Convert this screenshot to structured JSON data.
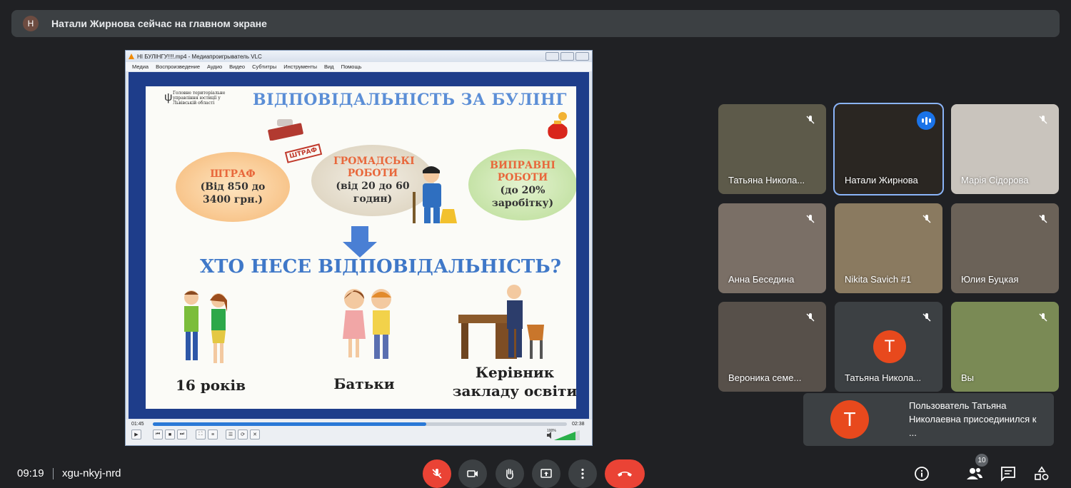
{
  "banner": {
    "avatar_letter": "Н",
    "text": "Натали Жирнова сейчас на главном экране"
  },
  "vlc": {
    "title": "НІ БУЛІНГУ!!!!.mp4 - Медиапроигрыватель VLC",
    "menu": [
      "Медиа",
      "Воспроизведение",
      "Аудио",
      "Видео",
      "Субтитры",
      "Инструменты",
      "Вид",
      "Помощь"
    ],
    "time_elapsed": "01:45",
    "time_total": "02:38",
    "progress": 0.66,
    "volume_label": "100%"
  },
  "slide": {
    "org": "Головне територіальне управління юстиції у Львівській області",
    "title": "ВІДПОВІДАЛЬНІСТЬ ЗА БУЛІНГ",
    "stamp": "ШТРАФ",
    "penalties": [
      {
        "title": "ШТРАФ",
        "body": "(Від 850 до 3400 грн.)"
      },
      {
        "title": "ГРОМАДСЬКІ РОБОТИ",
        "body": "(від 20 до 60 годин)"
      },
      {
        "title": "ВИПРАВНІ РОБОТИ",
        "body": "(до 20% заробітку)"
      }
    ],
    "question": "ХТО НЕСЕ ВІДПОВІДАЛЬНІСТЬ?",
    "captions": [
      "16 років",
      "Батьки",
      "Керівник закладу освіти"
    ]
  },
  "participants": [
    {
      "name": "Татьяна Никола...",
      "muted": true,
      "bg": "#5d5a4a"
    },
    {
      "name": "Натали Жирнова",
      "muted": false,
      "speaking": true,
      "bg": "#2a2622"
    },
    {
      "name": "Марія Сідорова",
      "muted": true,
      "bg": "#c9c4bd"
    },
    {
      "name": "Анна Беседина",
      "muted": true,
      "bg": "#7a6f66"
    },
    {
      "name": "Nikita Savich #1",
      "muted": true,
      "bg": "#8a7a60"
    },
    {
      "name": "Юлия Буцкая",
      "muted": true,
      "bg": "#6b6258"
    },
    {
      "name": "Вероника семе...",
      "muted": true,
      "bg": "#57504a"
    },
    {
      "name": "Татьяна Никола...",
      "muted": true,
      "avatar_letter": "Т",
      "bg": "#3c4043"
    },
    {
      "name": "Вы",
      "muted": true,
      "bg": "#7a8a55"
    }
  ],
  "toast": {
    "avatar_letter": "Т",
    "text": "Пользователь Татьяна Николаевна присоединился к ..."
  },
  "bottom": {
    "time": "09:19",
    "meeting_code": "xgu-nkyj-nrd",
    "people_count": "10"
  },
  "colors": {
    "accent": "#1a73e8",
    "danger": "#ea4335",
    "avatar": "#e8491d"
  }
}
